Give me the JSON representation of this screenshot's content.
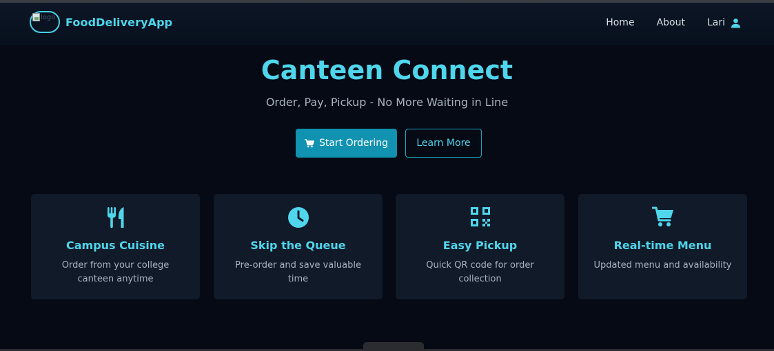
{
  "navbar": {
    "brand_name": "FoodDeliveryApp",
    "logo_alt": "logo",
    "links": {
      "home": "Home",
      "about": "About",
      "user": "Lari"
    },
    "user_icon": "user-icon"
  },
  "hero": {
    "title": "Canteen Connect",
    "subtitle": "Order, Pay, Pickup - No More Waiting in Line",
    "primary_button": "Start Ordering",
    "primary_button_icon": "cart-icon",
    "secondary_button": "Learn More"
  },
  "features": [
    {
      "icon": "utensils-icon",
      "title": "Campus Cuisine",
      "text": "Order from your college canteen anytime"
    },
    {
      "icon": "clock-icon",
      "title": "Skip the Queue",
      "text": "Pre-order and save valuable time"
    },
    {
      "icon": "qr-code-icon",
      "title": "Easy Pickup",
      "text": "Quick QR code for order collection"
    },
    {
      "icon": "cart-icon",
      "title": "Real-time Menu",
      "text": "Updated menu and availability"
    }
  ],
  "colors": {
    "background": "#050a14",
    "accent": "#4fd6ec",
    "primary_button": "#1092b0",
    "card": "#111a28",
    "muted_text": "#a9b3bf"
  }
}
